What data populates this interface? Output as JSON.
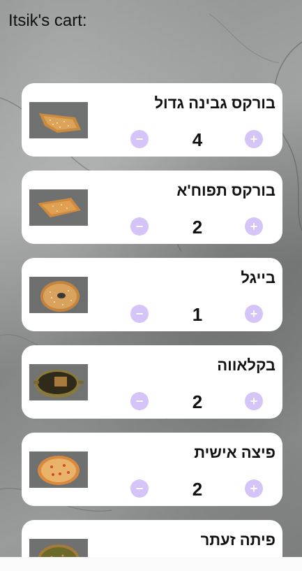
{
  "header": {
    "title": "Itsik's cart:"
  },
  "controls": {
    "minus_icon": "−",
    "plus_icon": "+"
  },
  "colors": {
    "button": "#d4c4f7",
    "card": "#ffffff"
  },
  "items": [
    {
      "name": "בורקס גבינה גדול",
      "quantity": "4",
      "image_icon": "cheese-borekas-image"
    },
    {
      "name": "בורקס תפוח'א",
      "quantity": "2",
      "image_icon": "potato-borekas-image"
    },
    {
      "name": "בייגל",
      "quantity": "1",
      "image_icon": "bagel-image"
    },
    {
      "name": "בקלאווה",
      "quantity": "2",
      "image_icon": "baklava-pan-image"
    },
    {
      "name": "פיצה אישית",
      "quantity": "2",
      "image_icon": "personal-pizza-image"
    },
    {
      "name": "פיתה זעתר",
      "quantity": "",
      "image_icon": "zaatar-pita-image"
    }
  ]
}
